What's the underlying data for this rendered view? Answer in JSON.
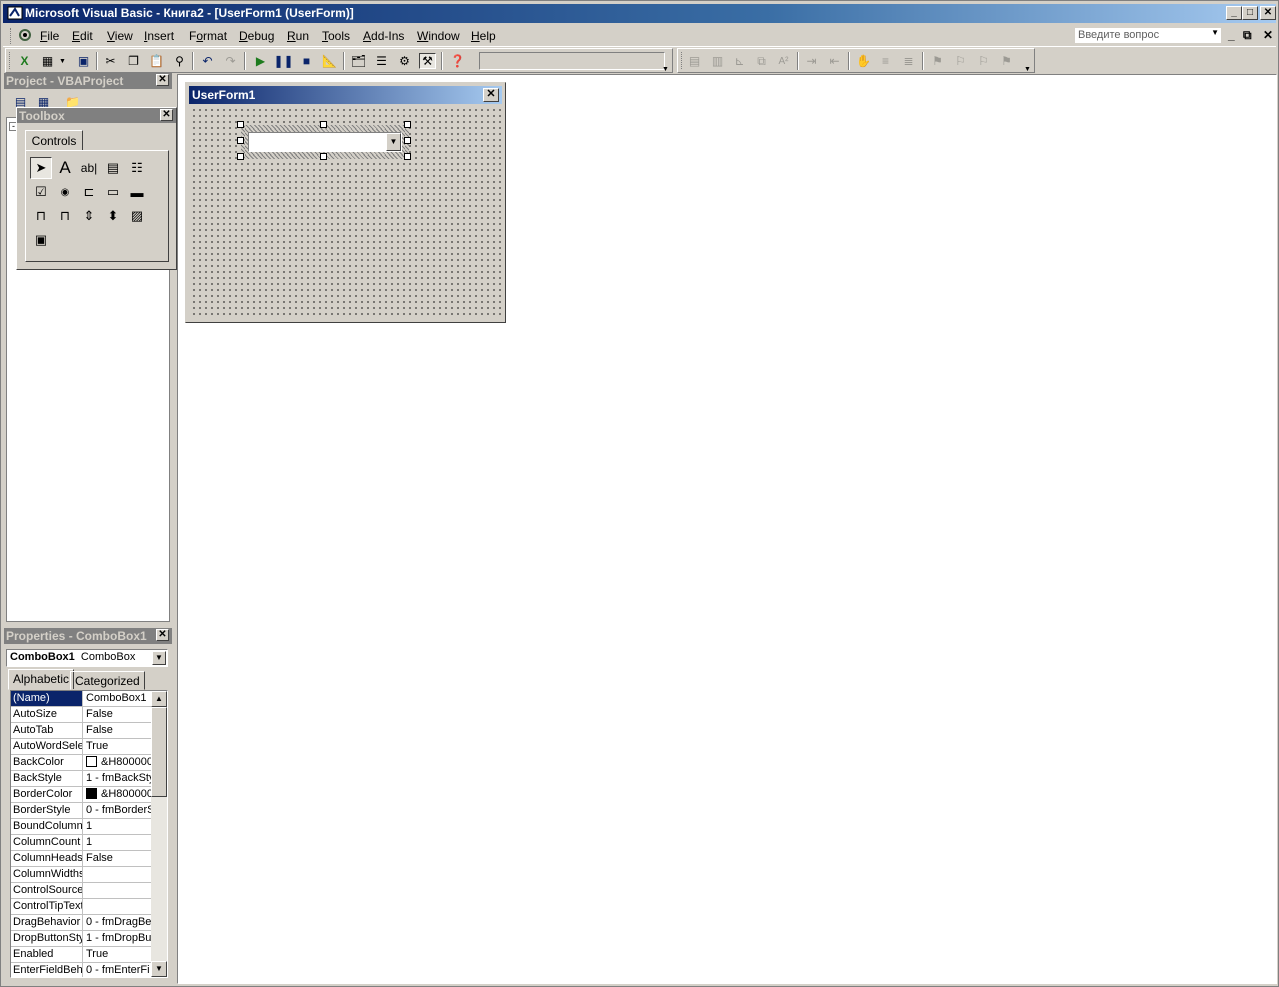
{
  "window": {
    "title": "Microsoft Visual Basic - Книга2 - [UserForm1 (UserForm)]"
  },
  "menu": {
    "items": [
      {
        "label": "File",
        "accel": "F"
      },
      {
        "label": "Edit",
        "accel": "E"
      },
      {
        "label": "View",
        "accel": "V"
      },
      {
        "label": "Insert",
        "accel": "I"
      },
      {
        "label": "Format",
        "accel": "o"
      },
      {
        "label": "Debug",
        "accel": "D"
      },
      {
        "label": "Run",
        "accel": "R"
      },
      {
        "label": "Tools",
        "accel": "T"
      },
      {
        "label": "Add-Ins",
        "accel": "A"
      },
      {
        "label": "Window",
        "accel": "W"
      },
      {
        "label": "Help",
        "accel": "H"
      }
    ],
    "ask_placeholder": "Введите вопрос"
  },
  "project": {
    "title": "Project - VBAProject"
  },
  "toolbox": {
    "title": "Toolbox",
    "tab": "Controls",
    "tools": [
      {
        "name": "select-objects",
        "glyph": "➤"
      },
      {
        "name": "label",
        "glyph": "A"
      },
      {
        "name": "textbox",
        "glyph": "ab|"
      },
      {
        "name": "combobox",
        "glyph": "▤"
      },
      {
        "name": "listbox",
        "glyph": "☷"
      },
      {
        "name": "checkbox",
        "glyph": "☑"
      },
      {
        "name": "optionbutton",
        "glyph": "◉"
      },
      {
        "name": "togglebutton",
        "glyph": "⊏"
      },
      {
        "name": "frame",
        "glyph": "▭"
      },
      {
        "name": "commandbutton",
        "glyph": "▬"
      },
      {
        "name": "tabstrip",
        "glyph": "⊓"
      },
      {
        "name": "multipage",
        "glyph": "⊓"
      },
      {
        "name": "scrollbar",
        "glyph": "⇕"
      },
      {
        "name": "spinbutton",
        "glyph": "⬍"
      },
      {
        "name": "image",
        "glyph": "▨"
      },
      {
        "name": "refedit",
        "glyph": "▣"
      }
    ]
  },
  "properties": {
    "title": "Properties - ComboBox1",
    "object_name": "ComboBox1",
    "object_type": "ComboBox",
    "tabs": [
      "Alphabetic",
      "Categorized"
    ],
    "rows": [
      {
        "name": "(Name)",
        "value": "ComboBox1"
      },
      {
        "name": "AutoSize",
        "value": "False"
      },
      {
        "name": "AutoTab",
        "value": "False"
      },
      {
        "name": "AutoWordSele",
        "value": "True"
      },
      {
        "name": "BackColor",
        "value": "&H800000",
        "swatch": "#ffffff"
      },
      {
        "name": "BackStyle",
        "value": "1 - fmBackSty"
      },
      {
        "name": "BorderColor",
        "value": "&H800000",
        "swatch": "#000000"
      },
      {
        "name": "BorderStyle",
        "value": "0 - fmBorderS"
      },
      {
        "name": "BoundColumn",
        "value": "1"
      },
      {
        "name": "ColumnCount",
        "value": "1"
      },
      {
        "name": "ColumnHeads",
        "value": "False"
      },
      {
        "name": "ColumnWidths",
        "value": ""
      },
      {
        "name": "ControlSource",
        "value": ""
      },
      {
        "name": "ControlTipText",
        "value": ""
      },
      {
        "name": "DragBehavior",
        "value": "0 - fmDragBe"
      },
      {
        "name": "DropButtonSty",
        "value": "1 - fmDropBu"
      },
      {
        "name": "Enabled",
        "value": "True"
      },
      {
        "name": "EnterFieldBeha",
        "value": "0 - fmEnterFi"
      }
    ]
  },
  "userform": {
    "title": "UserForm1"
  },
  "colors": {
    "face": "#d4d0c8",
    "title_active": "#0a246a",
    "title_inactive": "#808080",
    "selection": "#0a246a"
  }
}
